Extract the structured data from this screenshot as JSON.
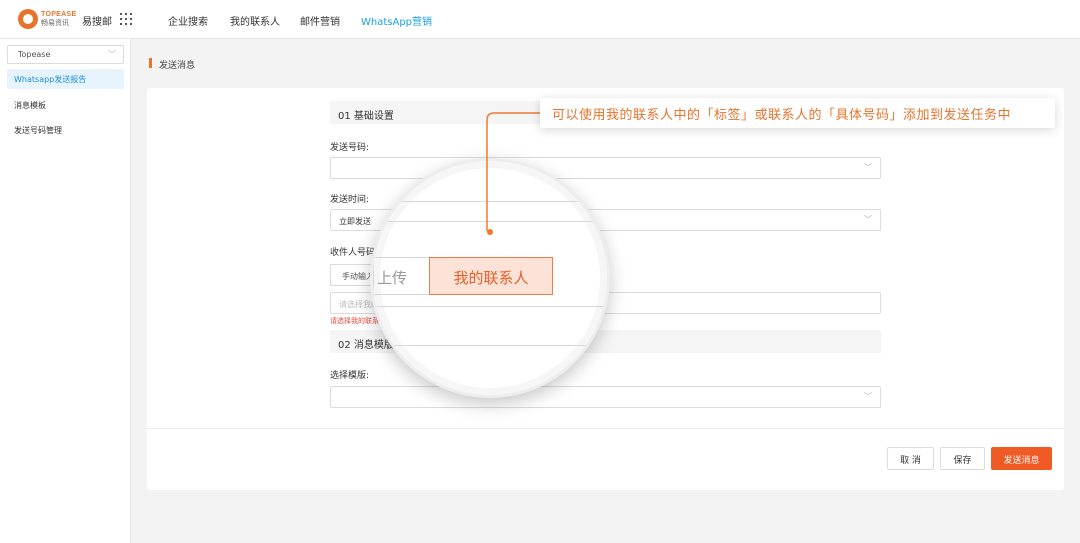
{
  "topbar": {
    "logo_en": "TOPEASE",
    "logo_cn": "畅易资讯",
    "app_name": "易搜邮",
    "nav": [
      "企业搜索",
      "我的联系人",
      "邮件营销",
      "WhatsApp营销"
    ],
    "active_color": "#1aa0e0"
  },
  "sidebar": {
    "tenant": "Topease",
    "items": [
      "Whatsapp发送报告",
      "消息模板",
      "发送号码管理"
    ]
  },
  "breadcrumb": "发送消息",
  "form": {
    "section1": "01 基础设置",
    "sender_label": "发送号码:",
    "sender_value": "",
    "time_label": "发送时间:",
    "time_value": "立即发送",
    "recipient_label": "收件人号码",
    "seg_manual": "手动输入",
    "recipient_placeholder": "请选择我的联系人",
    "error": "请选择我的联系人",
    "section2": "02 消息模版",
    "template_label": "选择模版:",
    "template_value": ""
  },
  "magnifier": {
    "upload": "上传",
    "contacts": "我的联系人"
  },
  "callout": "可以使用我的联系人中的「标签」或联系人的「具体号码」添加到发送任务中",
  "actions": {
    "cancel": "取 消",
    "save": "保存",
    "send": "发送消息"
  },
  "colors": {
    "accent": "#f05a24",
    "callout": "#e8742c",
    "sidebar_active": "#1a8fd8"
  }
}
